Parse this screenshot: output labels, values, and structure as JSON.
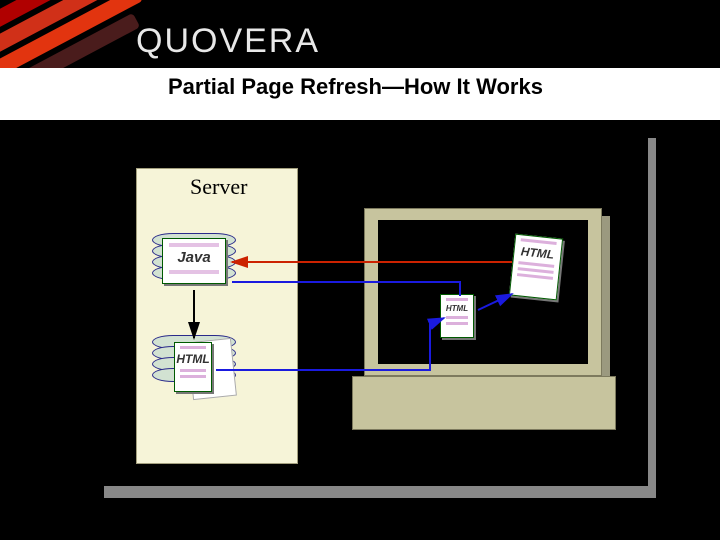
{
  "brand": "QUOVERA",
  "title": "Partial Page Refresh—How It Works",
  "server": {
    "label": "Server",
    "tech_card": "Java"
  },
  "docs": {
    "server_doc_label": "HTML",
    "mid_doc_label": "HTML",
    "right_doc_label": "HTML"
  }
}
